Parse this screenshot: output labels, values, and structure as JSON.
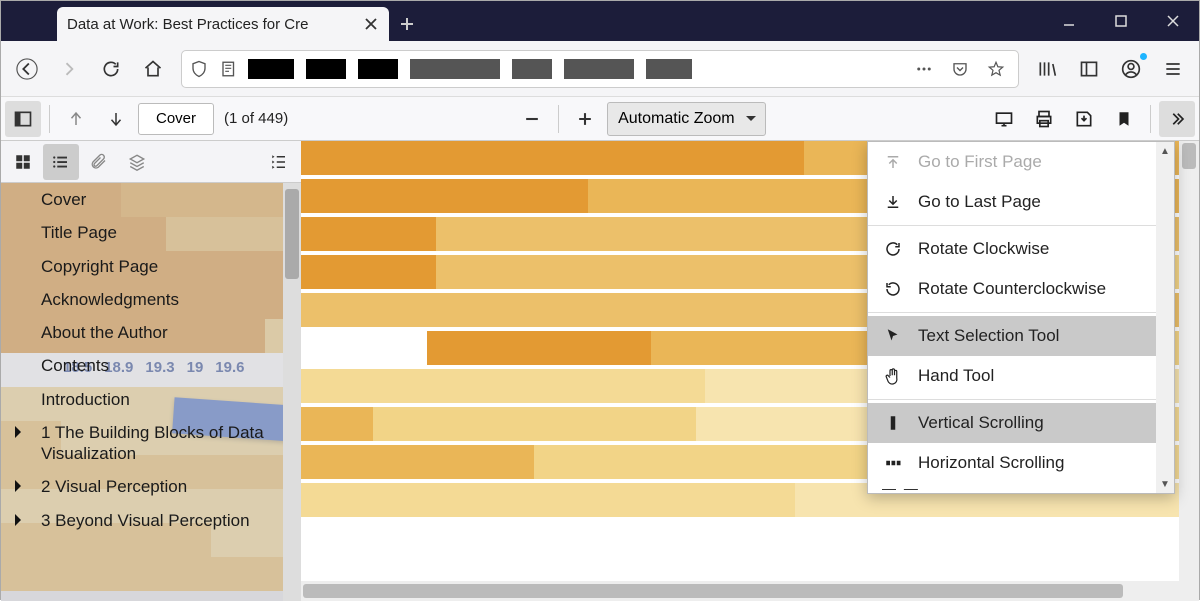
{
  "browser": {
    "tab_title": "Data at Work: Best Practices for Cre"
  },
  "pdf_toolbar": {
    "page_label": "Cover",
    "page_count": "(1 of 449)",
    "zoom_label": "Automatic Zoom"
  },
  "outline": {
    "items": [
      {
        "label": "Cover",
        "expandable": false
      },
      {
        "label": "Title Page",
        "expandable": false
      },
      {
        "label": "Copyright Page",
        "expandable": false
      },
      {
        "label": "Acknowledgments",
        "expandable": false
      },
      {
        "label": "About the Author",
        "expandable": false
      },
      {
        "label": "Contents",
        "expandable": false
      },
      {
        "label": "Introduction",
        "expandable": false
      },
      {
        "label": "1 The Building Blocks of Data Visualization",
        "expandable": true
      },
      {
        "label": "2 Visual Perception",
        "expandable": true
      },
      {
        "label": "3 Beyond Visual Perception",
        "expandable": true
      }
    ],
    "bg_numbers": [
      "18.5",
      "18.9",
      "19.3",
      "19",
      "19.6"
    ]
  },
  "menu": {
    "items": [
      {
        "id": "first",
        "label": "Go to First Page",
        "disabled": true
      },
      {
        "id": "last",
        "label": "Go to Last Page"
      },
      {
        "sep": true
      },
      {
        "id": "cw",
        "label": "Rotate Clockwise"
      },
      {
        "id": "ccw",
        "label": "Rotate Counterclockwise"
      },
      {
        "sep": true
      },
      {
        "id": "textsel",
        "label": "Text Selection Tool",
        "selected": true
      },
      {
        "id": "hand",
        "label": "Hand Tool"
      },
      {
        "sep": true
      },
      {
        "id": "vscroll",
        "label": "Vertical Scrolling",
        "selected": true
      },
      {
        "id": "hscroll",
        "label": "Horizontal Scrolling"
      }
    ]
  }
}
